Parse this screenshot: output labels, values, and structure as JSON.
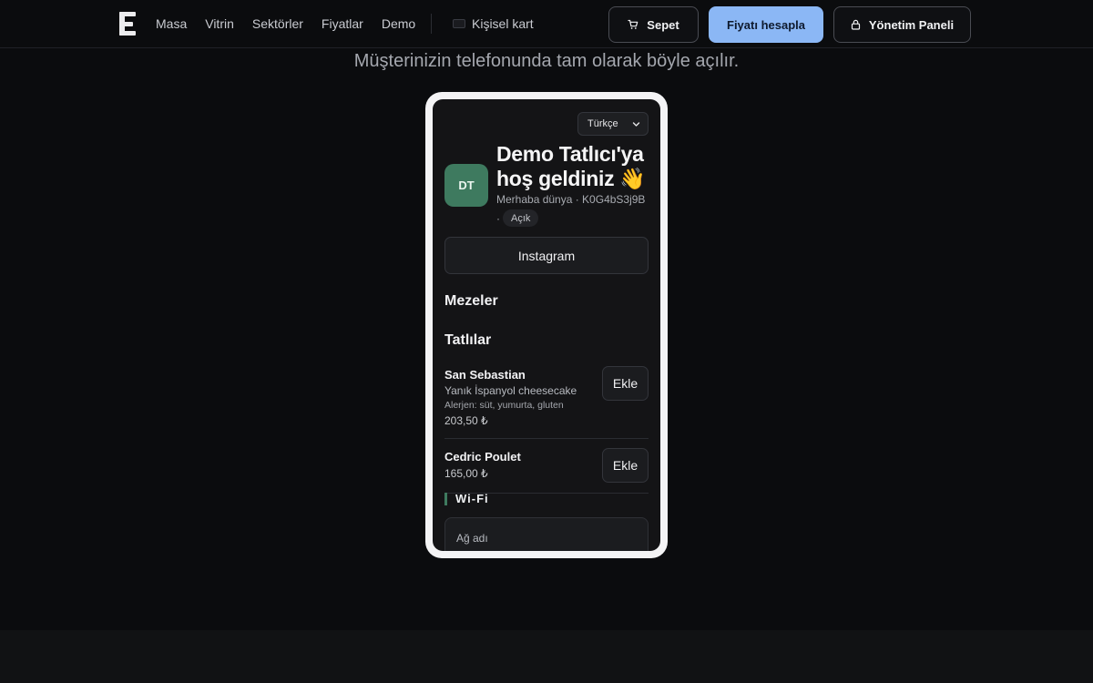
{
  "nav": {
    "items": [
      "Masa",
      "Vitrin",
      "Sektörler",
      "Fiyatlar",
      "Demo"
    ],
    "card_toggle_label": "Kişisel kart"
  },
  "actions": {
    "cart_label": "Sepet",
    "price_label": "Fiyatı hesapla",
    "admin_label": "Yönetim Paneli"
  },
  "colors": {
    "accent": "#8bb7f5",
    "avatar": "#3e7a5f",
    "background": "#0b0c0e"
  },
  "subtitle": "Müşterinizin telefonunda tam olarak böyle açılır.",
  "phone": {
    "language": "Türkçe",
    "avatar_initials": "DT",
    "welcome_line1": "Demo Tatlıcı'ya",
    "welcome_line2": "hoş geldiniz 👋",
    "meta": "Merhaba dünya · K0G4bS3j9B",
    "meta_sep": "·",
    "status": "Açık",
    "instagram_label": "Instagram",
    "sections": {
      "starters": "Mezeler",
      "desserts": "Tatlılar"
    },
    "items": [
      {
        "name": "San Sebastian",
        "description": "Yanık İspanyol cheesecake",
        "allergens": "Alerjen: süt, yumurta, gluten",
        "price": "203,50 ₺",
        "add_label": "Ekle"
      },
      {
        "name": "Cedric Poulet",
        "price": "165,00 ₺",
        "add_label": "Ekle"
      }
    ],
    "wifi": {
      "title": "Wi-Fi",
      "network_label": "Ağ adı"
    }
  }
}
